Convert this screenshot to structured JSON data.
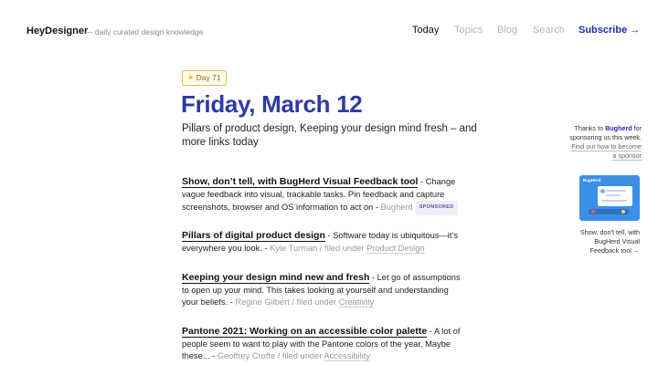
{
  "header": {
    "logo": "HeyDesigner",
    "tagline": "— daily curated design knowledge",
    "nav": {
      "today": "Today",
      "topics": "Topics",
      "blog": "Blog",
      "search": "Search",
      "subscribe": "Subscribe →"
    }
  },
  "issue": {
    "badge_icon": "☀",
    "badge": "Day 71",
    "date": "Friday, March 12",
    "subtitle": "Pillars of product design, Keeping your design mind fresh – and more links today"
  },
  "articles": [
    {
      "title": "Show, don’t tell, with BugHerd Visual Feedback tool",
      "description": " - Change vague feedback into visual, trackable tasks. Pin feedback and capture screenshots, browser and OS information to act on - ",
      "source": "Bugherd",
      "tag": "SPONSORED"
    },
    {
      "title": "Pillars of digital product design",
      "description": " - Software today is ubiquitous—it’s everywhere you look. - ",
      "source": "Kyle Turman / filed under ",
      "category": "Product Design"
    },
    {
      "title": "Keeping your design mind new and fresh",
      "description": " - Let go of assumptions to open up your mind. This takes looking at yourself and understanding your beliefs. - ",
      "source": "Regine Gilbert / filed under ",
      "category": "Creativity"
    },
    {
      "title": "Pantone 2021: Working on an accessible color palette",
      "description": " - A lot of people seem to want to play with the Pantone colors of the year. Maybe these... - ",
      "source": "Geoffrey Crofte / filed under ",
      "category": "Accessibility"
    }
  ],
  "sidebar": {
    "thanks_prefix": "Thanks to ",
    "sponsor": "Bugherd",
    "thanks_suffix": " for sponsoring us this week. ",
    "sponsor_link": "Find out how to become a sponsor",
    "ad_brand": "BugHerd",
    "ad_caption": "Show, don’t tell, with BugHerd Visual Feedback tool →"
  },
  "colors": {
    "accent": "#2f3aa3",
    "subscribe": "#1f2bb0",
    "badge_border": "#e4c34a",
    "ad_background": "#3b8fe6"
  }
}
